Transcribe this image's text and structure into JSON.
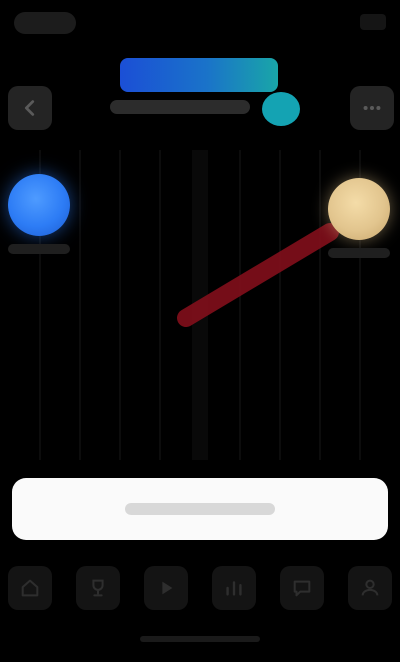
{
  "header": {
    "back_icon": "chevron-left-icon",
    "menu_icon": "more-icon"
  },
  "players": {
    "left": {
      "color": "#2d7cf5"
    },
    "right": {
      "color": "#e2c58e"
    }
  },
  "trajectory": {
    "color": "#8a0f1c"
  },
  "tabs": [
    {
      "icon": "home-icon"
    },
    {
      "icon": "trophy-icon"
    },
    {
      "icon": "play-icon"
    },
    {
      "icon": "chart-icon"
    },
    {
      "icon": "chat-icon"
    },
    {
      "icon": "user-icon"
    }
  ],
  "colors": {
    "background": "#000000",
    "accent_blue": "#1b4fd6",
    "accent_teal": "#14a3b3",
    "button": "#fafafa"
  }
}
